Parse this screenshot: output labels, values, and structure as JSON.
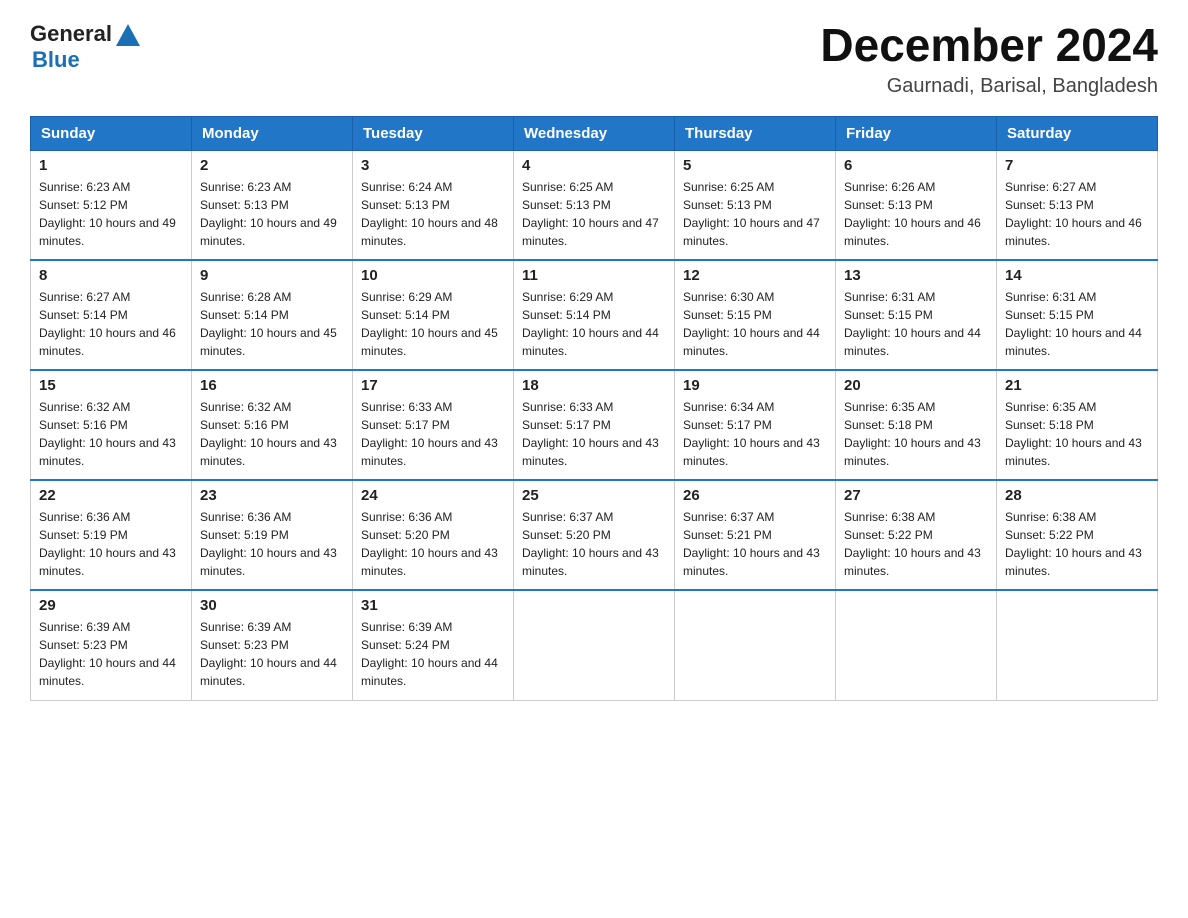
{
  "header": {
    "logo_general": "General",
    "logo_blue": "Blue",
    "month_title": "December 2024",
    "subtitle": "Gaurnadi, Barisal, Bangladesh"
  },
  "days_of_week": [
    "Sunday",
    "Monday",
    "Tuesday",
    "Wednesday",
    "Thursday",
    "Friday",
    "Saturday"
  ],
  "weeks": [
    [
      {
        "day": "1",
        "sunrise": "6:23 AM",
        "sunset": "5:12 PM",
        "daylight": "10 hours and 49 minutes."
      },
      {
        "day": "2",
        "sunrise": "6:23 AM",
        "sunset": "5:13 PM",
        "daylight": "10 hours and 49 minutes."
      },
      {
        "day": "3",
        "sunrise": "6:24 AM",
        "sunset": "5:13 PM",
        "daylight": "10 hours and 48 minutes."
      },
      {
        "day": "4",
        "sunrise": "6:25 AM",
        "sunset": "5:13 PM",
        "daylight": "10 hours and 47 minutes."
      },
      {
        "day": "5",
        "sunrise": "6:25 AM",
        "sunset": "5:13 PM",
        "daylight": "10 hours and 47 minutes."
      },
      {
        "day": "6",
        "sunrise": "6:26 AM",
        "sunset": "5:13 PM",
        "daylight": "10 hours and 46 minutes."
      },
      {
        "day": "7",
        "sunrise": "6:27 AM",
        "sunset": "5:13 PM",
        "daylight": "10 hours and 46 minutes."
      }
    ],
    [
      {
        "day": "8",
        "sunrise": "6:27 AM",
        "sunset": "5:14 PM",
        "daylight": "10 hours and 46 minutes."
      },
      {
        "day": "9",
        "sunrise": "6:28 AM",
        "sunset": "5:14 PM",
        "daylight": "10 hours and 45 minutes."
      },
      {
        "day": "10",
        "sunrise": "6:29 AM",
        "sunset": "5:14 PM",
        "daylight": "10 hours and 45 minutes."
      },
      {
        "day": "11",
        "sunrise": "6:29 AM",
        "sunset": "5:14 PM",
        "daylight": "10 hours and 44 minutes."
      },
      {
        "day": "12",
        "sunrise": "6:30 AM",
        "sunset": "5:15 PM",
        "daylight": "10 hours and 44 minutes."
      },
      {
        "day": "13",
        "sunrise": "6:31 AM",
        "sunset": "5:15 PM",
        "daylight": "10 hours and 44 minutes."
      },
      {
        "day": "14",
        "sunrise": "6:31 AM",
        "sunset": "5:15 PM",
        "daylight": "10 hours and 44 minutes."
      }
    ],
    [
      {
        "day": "15",
        "sunrise": "6:32 AM",
        "sunset": "5:16 PM",
        "daylight": "10 hours and 43 minutes."
      },
      {
        "day": "16",
        "sunrise": "6:32 AM",
        "sunset": "5:16 PM",
        "daylight": "10 hours and 43 minutes."
      },
      {
        "day": "17",
        "sunrise": "6:33 AM",
        "sunset": "5:17 PM",
        "daylight": "10 hours and 43 minutes."
      },
      {
        "day": "18",
        "sunrise": "6:33 AM",
        "sunset": "5:17 PM",
        "daylight": "10 hours and 43 minutes."
      },
      {
        "day": "19",
        "sunrise": "6:34 AM",
        "sunset": "5:17 PM",
        "daylight": "10 hours and 43 minutes."
      },
      {
        "day": "20",
        "sunrise": "6:35 AM",
        "sunset": "5:18 PM",
        "daylight": "10 hours and 43 minutes."
      },
      {
        "day": "21",
        "sunrise": "6:35 AM",
        "sunset": "5:18 PM",
        "daylight": "10 hours and 43 minutes."
      }
    ],
    [
      {
        "day": "22",
        "sunrise": "6:36 AM",
        "sunset": "5:19 PM",
        "daylight": "10 hours and 43 minutes."
      },
      {
        "day": "23",
        "sunrise": "6:36 AM",
        "sunset": "5:19 PM",
        "daylight": "10 hours and 43 minutes."
      },
      {
        "day": "24",
        "sunrise": "6:36 AM",
        "sunset": "5:20 PM",
        "daylight": "10 hours and 43 minutes."
      },
      {
        "day": "25",
        "sunrise": "6:37 AM",
        "sunset": "5:20 PM",
        "daylight": "10 hours and 43 minutes."
      },
      {
        "day": "26",
        "sunrise": "6:37 AM",
        "sunset": "5:21 PM",
        "daylight": "10 hours and 43 minutes."
      },
      {
        "day": "27",
        "sunrise": "6:38 AM",
        "sunset": "5:22 PM",
        "daylight": "10 hours and 43 minutes."
      },
      {
        "day": "28",
        "sunrise": "6:38 AM",
        "sunset": "5:22 PM",
        "daylight": "10 hours and 43 minutes."
      }
    ],
    [
      {
        "day": "29",
        "sunrise": "6:39 AM",
        "sunset": "5:23 PM",
        "daylight": "10 hours and 44 minutes."
      },
      {
        "day": "30",
        "sunrise": "6:39 AM",
        "sunset": "5:23 PM",
        "daylight": "10 hours and 44 minutes."
      },
      {
        "day": "31",
        "sunrise": "6:39 AM",
        "sunset": "5:24 PM",
        "daylight": "10 hours and 44 minutes."
      },
      null,
      null,
      null,
      null
    ]
  ]
}
